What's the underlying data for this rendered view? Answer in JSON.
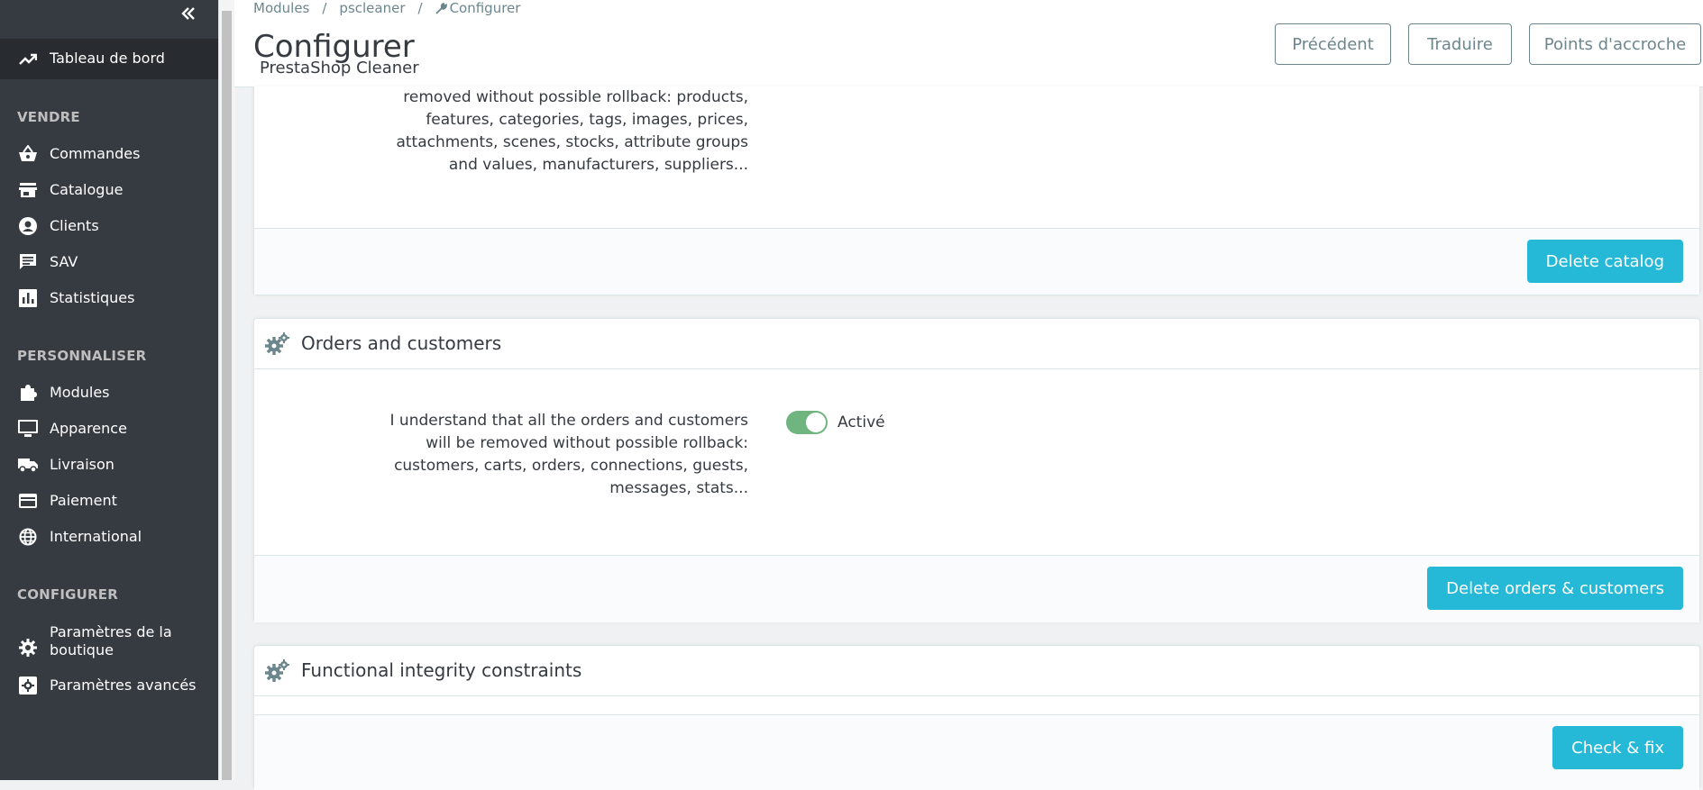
{
  "sidebar": {
    "collapse_icon": "double-chevron-left-icon",
    "dashboard": {
      "label": "Tableau de bord",
      "icon": "trending-up-icon"
    },
    "sections": [
      {
        "title": "VENDRE",
        "items": [
          {
            "label": "Commandes",
            "icon": "basket-icon"
          },
          {
            "label": "Catalogue",
            "icon": "store-icon"
          },
          {
            "label": "Clients",
            "icon": "account-circle-icon"
          },
          {
            "label": "SAV",
            "icon": "chat-icon"
          },
          {
            "label": "Statistiques",
            "icon": "bar-chart-icon"
          }
        ]
      },
      {
        "title": "PERSONNALISER",
        "items": [
          {
            "label": "Modules",
            "icon": "puzzle-icon"
          },
          {
            "label": "Apparence",
            "icon": "desktop-icon"
          },
          {
            "label": "Livraison",
            "icon": "truck-icon"
          },
          {
            "label": "Paiement",
            "icon": "credit-card-icon"
          },
          {
            "label": "International",
            "icon": "globe-icon"
          }
        ]
      },
      {
        "title": "CONFIGURER",
        "items": [
          {
            "label": "Paramètres de la boutique",
            "icon": "gear-icon"
          },
          {
            "label": "Paramètres avancés",
            "icon": "settings-applications-icon"
          }
        ]
      }
    ]
  },
  "header": {
    "breadcrumb": [
      "Modules",
      "pscleaner",
      "Configurer"
    ],
    "title": "Configurer",
    "subtitle": "PrestaShop Cleaner",
    "buttons": [
      "Précédent",
      "Traduire",
      "Points d'accroche"
    ]
  },
  "panels": {
    "catalog": {
      "description_lines": [
        "removed without possible rollback: products,",
        "features, categories, tags, images, prices,",
        "attachments, scenes, stocks, attribute groups",
        "and values, manufacturers, suppliers..."
      ],
      "button": "Delete catalog"
    },
    "orders": {
      "title": "Orders and customers",
      "description_lines": [
        "I understand that all the orders and customers",
        "will be removed without possible rollback:",
        "customers, carts, orders, connections, guests,",
        "messages, stats..."
      ],
      "toggle_label": "Activé",
      "toggle_on": true,
      "button": "Delete orders & customers"
    },
    "integrity": {
      "title": "Functional integrity constraints",
      "button": "Check & fix"
    }
  },
  "colors": {
    "sidebar_bg": "#363a41",
    "primary": "#25b9d7",
    "toggle_on": "#70b580"
  }
}
